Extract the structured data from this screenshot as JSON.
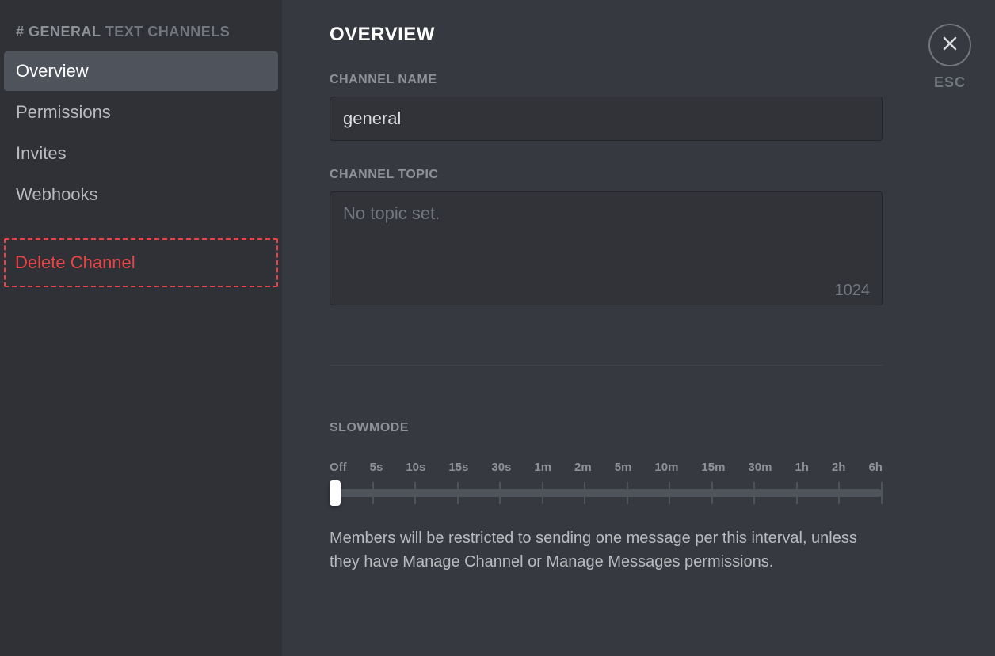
{
  "sidebar": {
    "hash": "#",
    "channel_name": "GENERAL",
    "category": "TEXT CHANNELS",
    "items": [
      {
        "label": "Overview",
        "active": true
      },
      {
        "label": "Permissions",
        "active": false
      },
      {
        "label": "Invites",
        "active": false
      },
      {
        "label": "Webhooks",
        "active": false
      }
    ],
    "delete_label": "Delete Channel"
  },
  "page": {
    "title": "OVERVIEW"
  },
  "channel_name_field": {
    "label": "CHANNEL NAME",
    "value": "general"
  },
  "channel_topic_field": {
    "label": "CHANNEL TOPIC",
    "placeholder": "No topic set.",
    "value": "",
    "char_limit": "1024"
  },
  "slowmode": {
    "label": "SLOWMODE",
    "ticks": [
      "Off",
      "5s",
      "10s",
      "15s",
      "30s",
      "1m",
      "2m",
      "5m",
      "10m",
      "15m",
      "30m",
      "1h",
      "2h",
      "6h"
    ],
    "help": "Members will be restricted to sending one message per this interval, unless they have Manage Channel or Manage Messages permissions."
  },
  "close": {
    "esc_label": "ESC"
  }
}
